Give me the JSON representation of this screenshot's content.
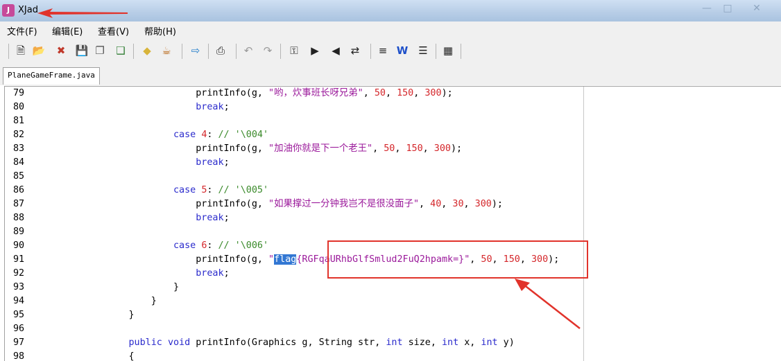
{
  "window": {
    "title": "XJad",
    "icon": "xjad-app-icon"
  },
  "menu": {
    "items": [
      "文件(F)",
      "编辑(E)",
      "查看(V)",
      "帮助(H)"
    ]
  },
  "toolbar": {
    "icons": [
      "new-file-icon",
      "open-folder-icon",
      "close-file-icon",
      "save-icon",
      "save-as-icon",
      "save-all-icon",
      "diamond-icon",
      "java-cup-icon",
      "export-icon",
      "print-icon",
      "undo-icon",
      "redo-icon",
      "find-icon",
      "find-next-icon",
      "find-prev-icon",
      "replace-icon",
      "format-icon",
      "word-wrap-icon",
      "list-icon",
      "properties-icon"
    ]
  },
  "tab": {
    "label": "PlaneGameFrame.java"
  },
  "code": {
    "lines": [
      {
        "n": "79",
        "parts": [
          [
            "",
            "                    printInfo(g, "
          ],
          [
            "str",
            "\"哟，炊事班长呀兄弟\""
          ],
          [
            "",
            ", "
          ],
          [
            "num",
            "50"
          ],
          [
            "",
            ", "
          ],
          [
            "num",
            "150"
          ],
          [
            "",
            ", "
          ],
          [
            "num",
            "300"
          ],
          [
            "",
            ");"
          ]
        ]
      },
      {
        "n": "80",
        "parts": [
          [
            "",
            "                    "
          ],
          [
            "kw",
            "break"
          ],
          [
            "",
            ";"
          ]
        ]
      },
      {
        "n": "81",
        "parts": []
      },
      {
        "n": "82",
        "parts": [
          [
            "",
            "                "
          ],
          [
            "kw",
            "case"
          ],
          [
            "",
            " "
          ],
          [
            "num",
            "4"
          ],
          [
            "",
            ": "
          ],
          [
            "cmt",
            "// '\\004'"
          ]
        ]
      },
      {
        "n": "83",
        "parts": [
          [
            "",
            "                    printInfo(g, "
          ],
          [
            "str",
            "\"加油你就是下一个老王\""
          ],
          [
            "",
            ", "
          ],
          [
            "num",
            "50"
          ],
          [
            "",
            ", "
          ],
          [
            "num",
            "150"
          ],
          [
            "",
            ", "
          ],
          [
            "num",
            "300"
          ],
          [
            "",
            ");"
          ]
        ]
      },
      {
        "n": "84",
        "parts": [
          [
            "",
            "                    "
          ],
          [
            "kw",
            "break"
          ],
          [
            "",
            ";"
          ]
        ]
      },
      {
        "n": "85",
        "parts": []
      },
      {
        "n": "86",
        "parts": [
          [
            "",
            "                "
          ],
          [
            "kw",
            "case"
          ],
          [
            "",
            " "
          ],
          [
            "num",
            "5"
          ],
          [
            "",
            ": "
          ],
          [
            "cmt",
            "// '\\005'"
          ]
        ]
      },
      {
        "n": "87",
        "parts": [
          [
            "",
            "                    printInfo(g, "
          ],
          [
            "str",
            "\"如果撑过一分钟我岂不是很没面子\""
          ],
          [
            "",
            ", "
          ],
          [
            "num",
            "40"
          ],
          [
            "",
            ", "
          ],
          [
            "num",
            "30"
          ],
          [
            "",
            ", "
          ],
          [
            "num",
            "300"
          ],
          [
            "",
            ");"
          ]
        ]
      },
      {
        "n": "88",
        "parts": [
          [
            "",
            "                    "
          ],
          [
            "kw",
            "break"
          ],
          [
            "",
            ";"
          ]
        ]
      },
      {
        "n": "89",
        "parts": []
      },
      {
        "n": "90",
        "parts": [
          [
            "",
            "                "
          ],
          [
            "kw",
            "case"
          ],
          [
            "",
            " "
          ],
          [
            "num",
            "6"
          ],
          [
            "",
            ": "
          ],
          [
            "cmt",
            "// '\\006'"
          ]
        ]
      },
      {
        "n": "91",
        "parts": [
          [
            "",
            "                    printInfo(g, "
          ],
          [
            "str",
            "\""
          ],
          [
            "hl",
            "flag"
          ],
          [
            "str",
            "{RGFqaURhbGlfSmlud2FuQ2hpamk=}\""
          ],
          [
            "",
            ", "
          ],
          [
            "num",
            "50"
          ],
          [
            "",
            ", "
          ],
          [
            "num",
            "150"
          ],
          [
            "",
            ", "
          ],
          [
            "num",
            "300"
          ],
          [
            "",
            ");"
          ]
        ]
      },
      {
        "n": "92",
        "parts": [
          [
            "",
            "                    "
          ],
          [
            "kw",
            "break"
          ],
          [
            "",
            ";"
          ]
        ]
      },
      {
        "n": "93",
        "parts": [
          [
            "",
            "                }"
          ]
        ]
      },
      {
        "n": "94",
        "parts": [
          [
            "",
            "            }"
          ]
        ]
      },
      {
        "n": "95",
        "parts": [
          [
            "",
            "        }"
          ]
        ]
      },
      {
        "n": "96",
        "parts": []
      },
      {
        "n": "97",
        "parts": [
          [
            "",
            "        "
          ],
          [
            "kw",
            "public"
          ],
          [
            "",
            " "
          ],
          [
            "kw",
            "void"
          ],
          [
            "",
            " printInfo(Graphics g, String str, "
          ],
          [
            "kw",
            "int"
          ],
          [
            "",
            " size, "
          ],
          [
            "kw",
            "int"
          ],
          [
            "",
            " x, "
          ],
          [
            "kw",
            "int"
          ],
          [
            "",
            " y)"
          ]
        ]
      },
      {
        "n": "98",
        "parts": [
          [
            "",
            "        {"
          ]
        ]
      }
    ]
  },
  "colors": {
    "keyword": "#2a2acc",
    "number": "#d4262a",
    "string": "#9b1a9b",
    "comment": "#3a8a2a",
    "selection": "#3277d3",
    "annotation": "#e1332b"
  }
}
